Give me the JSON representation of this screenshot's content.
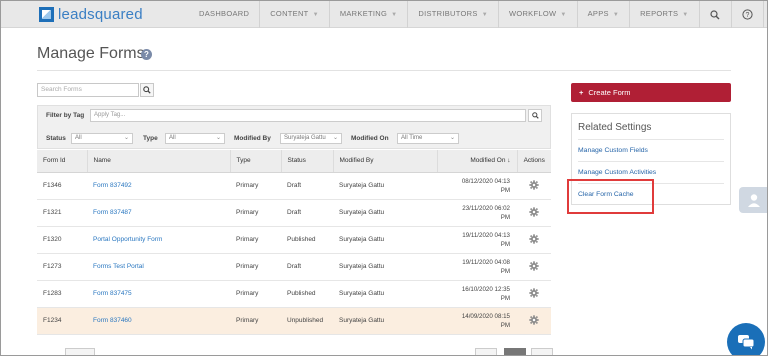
{
  "app": {
    "logo_text": "leadsquared"
  },
  "nav": {
    "items": [
      {
        "label": "DASHBOARD",
        "caret": false
      },
      {
        "label": "CONTENT",
        "caret": true
      },
      {
        "label": "MARKETING",
        "caret": true
      },
      {
        "label": "DISTRIBUTORS",
        "caret": true
      },
      {
        "label": "WORKFLOW",
        "caret": true
      },
      {
        "label": "APPS",
        "caret": true
      },
      {
        "label": "REPORTS",
        "caret": true
      }
    ],
    "icons": [
      "search-icon",
      "help-icon",
      "user-menu-icon"
    ]
  },
  "page": {
    "title": "Manage Forms",
    "help_icon": "?"
  },
  "search": {
    "placeholder": "Search Forms"
  },
  "filters": {
    "tag_label": "Filter by Tag",
    "tag_placeholder": "Apply Tag...",
    "status_label": "Status",
    "status_value": "All",
    "type_label": "Type",
    "type_value": "All",
    "modified_by_label": "Modified By",
    "modified_by_value": "Suryateja Gattu",
    "modified_on_label": "Modified On",
    "modified_on_value": "All Time"
  },
  "table": {
    "headers": {
      "form_id": "Form Id",
      "name": "Name",
      "type": "Type",
      "status": "Status",
      "modified_by": "Modified By",
      "modified_on": "Modified On",
      "sort_indicator": "↓",
      "actions": "Actions"
    },
    "rows": [
      {
        "id": "F1346",
        "name": "Form 837492",
        "type": "Primary",
        "status": "Draft",
        "modified_by": "Suryateja Gattu",
        "date": "08/12/2020 04:13",
        "ampm": "PM",
        "highlight": false
      },
      {
        "id": "F1321",
        "name": "Form 837487",
        "type": "Primary",
        "status": "Draft",
        "modified_by": "Suryateja Gattu",
        "date": "23/11/2020 06:02",
        "ampm": "PM",
        "highlight": false
      },
      {
        "id": "F1320",
        "name": "Portal Opportunity Form",
        "type": "Primary",
        "status": "Published",
        "modified_by": "Suryateja Gattu",
        "date": "19/11/2020 04:13",
        "ampm": "PM",
        "highlight": false
      },
      {
        "id": "F1273",
        "name": "Forms Test Portal",
        "type": "Primary",
        "status": "Draft",
        "modified_by": "Suryateja Gattu",
        "date": "19/11/2020 04:08",
        "ampm": "PM",
        "highlight": false
      },
      {
        "id": "F1283",
        "name": "Form 837475",
        "type": "Primary",
        "status": "Published",
        "modified_by": "Suryateja Gattu",
        "date": "16/10/2020 12:35",
        "ampm": "PM",
        "highlight": false
      },
      {
        "id": "F1234",
        "name": "Form 837460",
        "type": "Primary",
        "status": "Unpublished",
        "modified_by": "Suryateja Gattu",
        "date": "14/09/2020 08:15",
        "ampm": "PM",
        "highlight": true
      }
    ]
  },
  "sidebar": {
    "create_label": "Create Form",
    "create_plus": "+",
    "related_title": "Related Settings",
    "links": [
      {
        "label": "Manage Custom Fields"
      },
      {
        "label": "Manage Custom Activities"
      },
      {
        "label": "Clear Form Cache"
      }
    ]
  },
  "colors": {
    "brand": "#1e6fb8",
    "create_button": "#b01f35",
    "link": "#2a77c0",
    "highlight_row": "#fbeee0",
    "callout": "#e03b3b"
  }
}
